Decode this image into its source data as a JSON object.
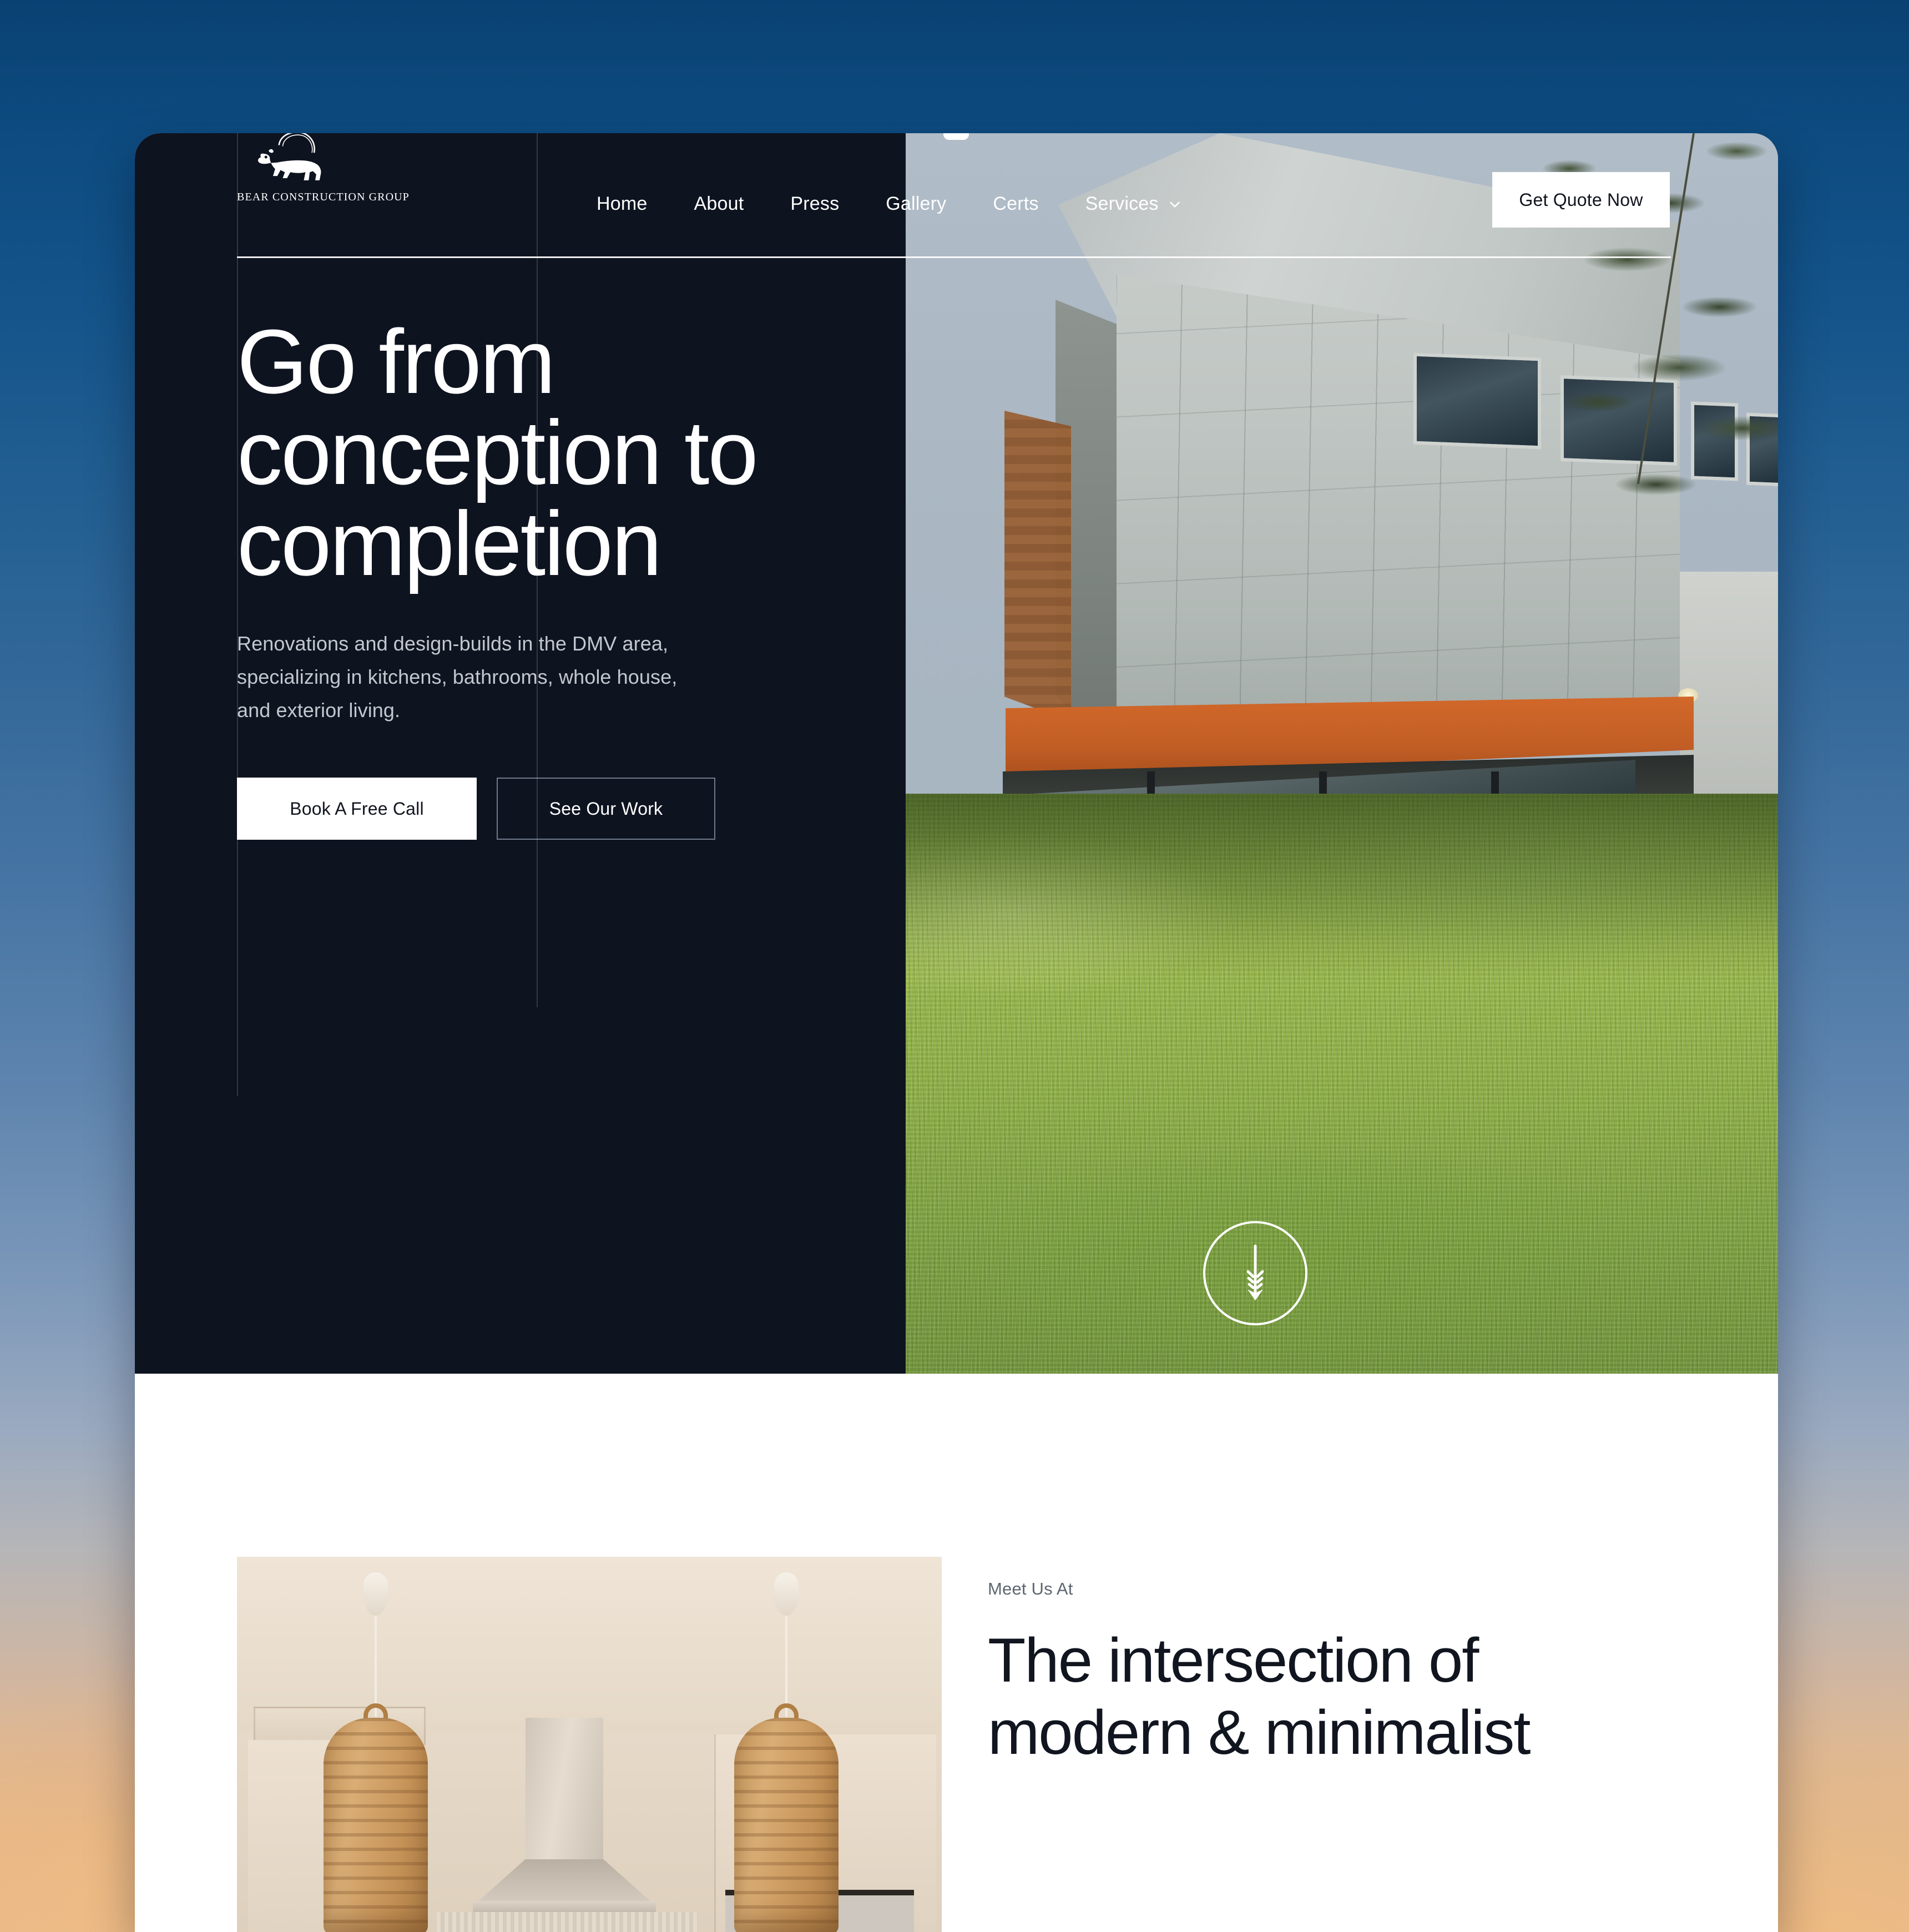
{
  "brand": {
    "logo_icon": "bear-logo-icon",
    "wordmark": "BEAR CONSTRUCTION GROUP"
  },
  "nav": {
    "items": [
      {
        "label": "Home",
        "has_dropdown": false
      },
      {
        "label": "About",
        "has_dropdown": false
      },
      {
        "label": "Press",
        "has_dropdown": false
      },
      {
        "label": "Gallery",
        "has_dropdown": false
      },
      {
        "label": "Certs",
        "has_dropdown": false
      },
      {
        "label": "Services",
        "has_dropdown": true
      }
    ],
    "cta_label": "Get Quote Now"
  },
  "hero": {
    "title_line1": "Go from",
    "title_line2": "conception to",
    "title_line3": "completion",
    "subtitle_line1": "Renovations and design-builds in the DMV area,",
    "subtitle_line2": "specializing in kitchens, bathrooms, whole house,",
    "subtitle_line3": "and exterior living.",
    "primary_button": "Book A Free Call",
    "secondary_button": "See Our Work",
    "scroll_icon": "arrow-down-icon",
    "image_alt": "modern two-story house with concrete panel facade and orange soffit over a covered patio on a green lawn"
  },
  "meet": {
    "eyebrow": "Meet Us At",
    "title_line1": "The intersection of",
    "title_line2": "modern & minimalist",
    "image_alt": "bright minimalist kitchen with two woven rattan pendant lights and a stainless range hood"
  },
  "colors": {
    "hero_background": "#0e1320",
    "page_background": "#ffffff",
    "accent_white": "#ffffff",
    "muted_text": "#c3c7ce",
    "eyebrow_text": "#5d6670",
    "heading_dark": "#10151f",
    "ghost_border": "#6f7a88",
    "backdrop_top": "#0a4173",
    "backdrop_bottom": "#f0c088"
  }
}
